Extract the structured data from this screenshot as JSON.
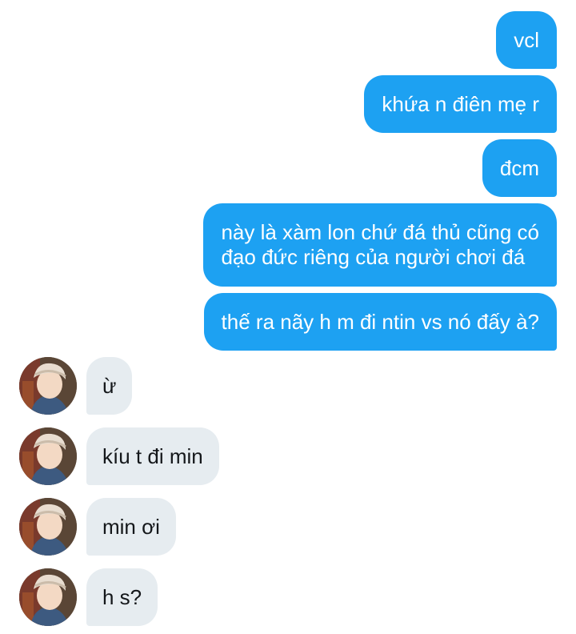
{
  "conversation": {
    "outgoing": [
      "vcl",
      "khứa n điên mẹ r",
      "đcm",
      [
        "này là xàm lon chứ đá thủ cũng có",
        "đạo đức riêng của người chơi đá"
      ],
      "thế ra nãy h m đi ntin vs nó đấy à?"
    ],
    "incoming": [
      "ừ",
      "kíu t đi min",
      "min ơi",
      "h s?"
    ]
  },
  "colors": {
    "outgoing_bubble": "#1da1f2",
    "incoming_bubble": "#e6ecf0"
  },
  "icons": {
    "avatar": "user-avatar-photo"
  }
}
